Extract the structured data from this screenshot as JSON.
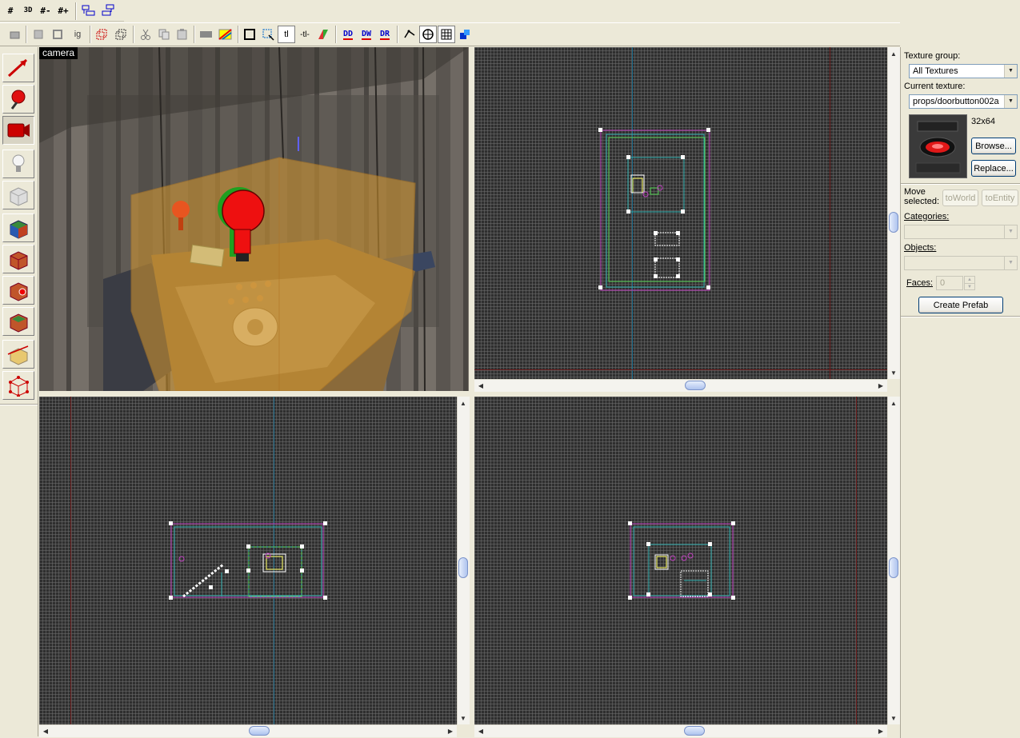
{
  "toolbar_top": {
    "buttons": [
      {
        "label": "#",
        "icon": "grid-2d-icon"
      },
      {
        "label": "3D",
        "icon": "grid-3d-icon"
      },
      {
        "label": "#-",
        "icon": "smaller-grid-icon"
      },
      {
        "label": "#+",
        "icon": "larger-grid-icon"
      }
    ]
  },
  "toolbar_main": {
    "ig_label": "ig",
    "tl_label": "tl",
    "tl2_label": "-tl-",
    "dd_label": "DD",
    "dw_label": "DW",
    "dr_label": "DR"
  },
  "camera": {
    "label": "camera"
  },
  "right_panel": {
    "texture_group_label": "Texture group:",
    "texture_group_value": "All Textures",
    "current_texture_label": "Current texture:",
    "current_texture_value": "props/doorbutton002a",
    "texture_size": "32x64",
    "browse_label": "Browse...",
    "replace_label": "Replace...",
    "move_selected_label_1": "Move",
    "move_selected_label_2": "selected:",
    "to_world_label": "toWorld",
    "to_entity_label": "toEntity",
    "categories_label": "Categories:",
    "categories_value": "",
    "objects_label": "Objects:",
    "objects_value": "",
    "faces_label": "Faces:",
    "faces_value": "0",
    "create_prefab_label": "Create Prefab"
  },
  "colors": {
    "grid_bg": "#2f2f2f",
    "selection_magenta": "#c040c0",
    "selection_cyan": "#30b0b0",
    "selection_green": "#50d050",
    "handle_white": "#ffffff",
    "accent_blue": "#0000cc"
  }
}
